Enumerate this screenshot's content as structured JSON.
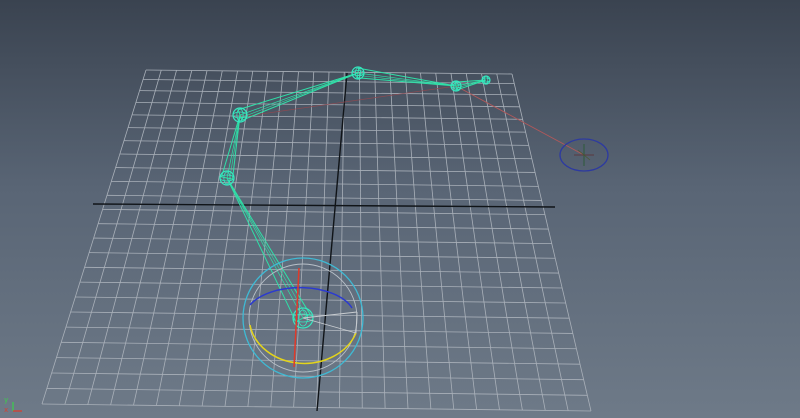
{
  "viewport": {
    "label": "perspective-viewport",
    "background_top": "#3a4350",
    "background_bottom": "#6e7a88"
  },
  "colors": {
    "grid": "#a9b0b9",
    "axis": "#101418",
    "joint": "#35e9c0",
    "bone": "#2fe0a8",
    "ik_handle": "#2d3aa0",
    "handle_line": "#b0585a",
    "manip_outer": "#3fbad4",
    "manip_x": "#e03a2a",
    "manip_y": "#e4d41a",
    "manip_z": "#2b3ad0",
    "manip_view": "#b8c0c8"
  },
  "axis_indicator": {
    "y_label": "y",
    "x_label": "x",
    "y_color": "#3ad04a",
    "x_color": "#e03a2a"
  },
  "icons": {
    "ik_handle": "ik-handle-icon",
    "rotate_manipulator": "rotate-manipulator-icon",
    "axis_indicator": "axis-indicator-icon"
  }
}
